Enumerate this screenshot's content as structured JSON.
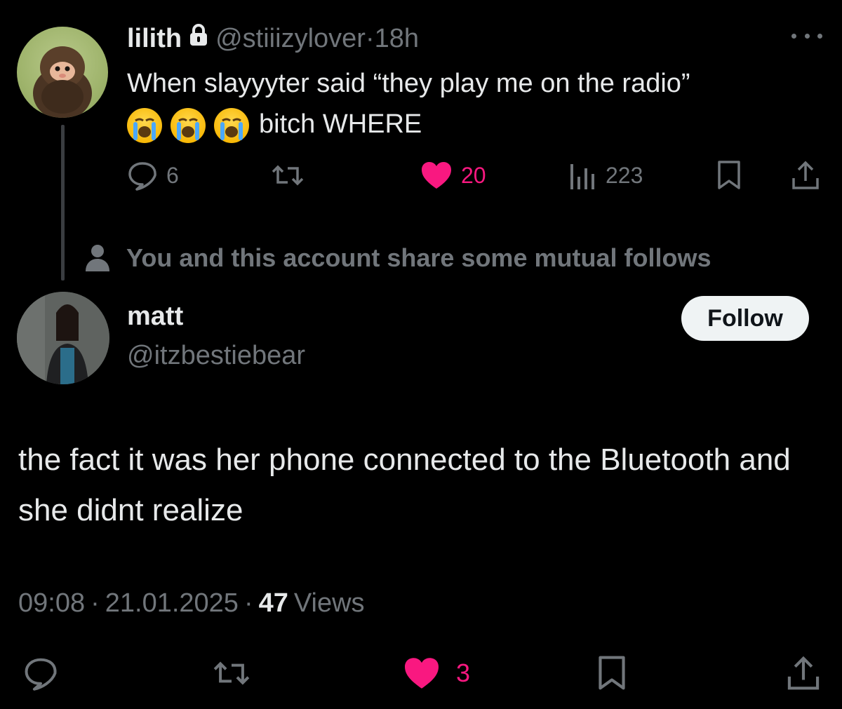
{
  "parent": {
    "name": "lilith",
    "handle": "@stiiizylover",
    "separator": "·",
    "time": "18h",
    "text_line1": "When slayyyter said “they play me on the radio”",
    "text_line2": "bitch WHERE",
    "emoji": "loudly-crying-face",
    "emoji_count": 3,
    "counts": {
      "replies": "6",
      "likes": "20",
      "views": "223"
    }
  },
  "mutual_note": "You and this account share some mutual follows",
  "reply": {
    "name": "matt",
    "handle": "@itzbestiebear",
    "follow_label": "Follow",
    "text": "the fact it was her phone connected to the Bluetooth and she didnt realize",
    "time": "09:08",
    "separator": "·",
    "date": "21.01.2025",
    "views_count": "47",
    "views_label": "Views",
    "counts": {
      "likes": "3"
    }
  },
  "colors": {
    "background": "#000000",
    "primary_text": "#e7e9ea",
    "secondary_text": "#71767b",
    "like_pink": "#f91880",
    "follow_bg": "#eff3f4"
  }
}
